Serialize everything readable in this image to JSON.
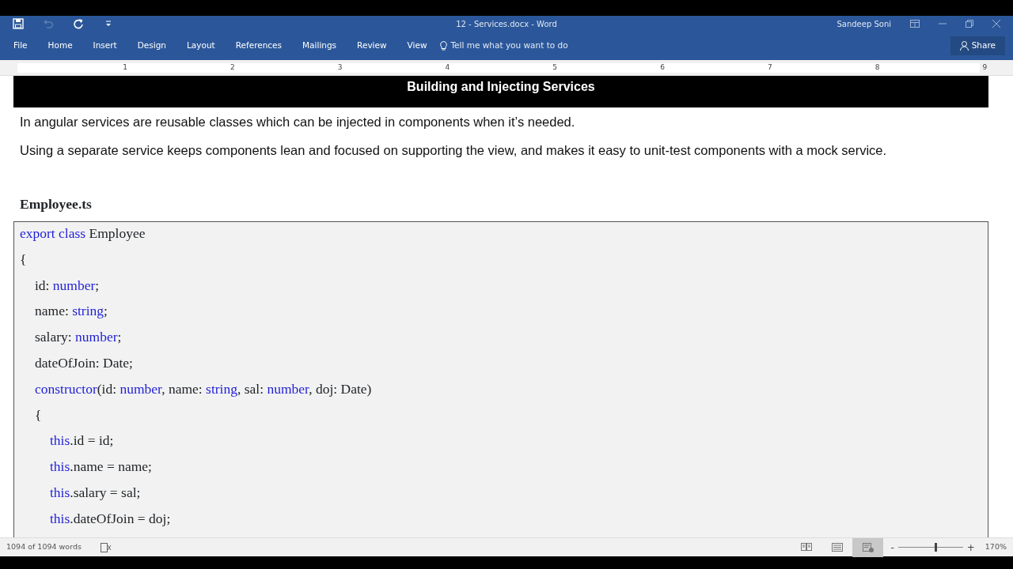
{
  "window": {
    "title": "12 - Services.docx  -  Word",
    "user": "Sandeep Soni"
  },
  "quick_access": [
    {
      "kind": "save",
      "disabled": false
    },
    {
      "kind": "undo",
      "disabled": true
    },
    {
      "kind": "repeat",
      "disabled": false
    },
    {
      "kind": "customize",
      "disabled": false
    }
  ],
  "ribbon_tabs": [
    {
      "label": "File"
    },
    {
      "label": "Home"
    },
    {
      "label": "Insert"
    },
    {
      "label": "Design"
    },
    {
      "label": "Layout"
    },
    {
      "label": "References"
    },
    {
      "label": "Mailings"
    },
    {
      "label": "Review"
    },
    {
      "label": "View"
    }
  ],
  "tell_me": {
    "placeholder": "Tell me what you want to do"
  },
  "share_button": "Share",
  "ruler": [
    "1",
    "2",
    "3",
    "4",
    "5",
    "6",
    "7",
    "8",
    "9"
  ],
  "document": {
    "heading": "Building and Injecting Services",
    "paragraphs": [
      "In angular services are reusable classes which can be injected in components when it’s needed.",
      "Using a separate service keeps components lean and focused on supporting the view, and makes it easy to unit-test components with a mock service."
    ],
    "file_heading": "Employee.ts",
    "code": [
      {
        "tokens": [
          {
            "text": "export class",
            "kind": "keyword"
          },
          {
            "text": " Employee",
            "kind": "plain"
          }
        ]
      },
      {
        "tokens": [
          {
            "text": "{",
            "kind": "plain"
          }
        ],
        "children": [
          {
            "tokens": [
              {
                "text": "id: ",
                "kind": "plain"
              },
              {
                "text": "number",
                "kind": "keyword"
              },
              {
                "text": ";",
                "kind": "plain"
              }
            ]
          },
          {
            "tokens": [
              {
                "text": "name: ",
                "kind": "plain"
              },
              {
                "text": "string",
                "kind": "keyword"
              },
              {
                "text": ";",
                "kind": "plain"
              }
            ]
          },
          {
            "tokens": [
              {
                "text": "salary: ",
                "kind": "plain"
              },
              {
                "text": "number",
                "kind": "keyword"
              },
              {
                "text": ";",
                "kind": "plain"
              }
            ]
          },
          {
            "tokens": [
              {
                "text": "dateOfJoin: Date;",
                "kind": "plain"
              }
            ]
          },
          {
            "tokens": [
              {
                "text": "constructor",
                "kind": "keyword"
              },
              {
                "text": "(id: ",
                "kind": "plain"
              },
              {
                "text": "number",
                "kind": "keyword"
              },
              {
                "text": ", name: ",
                "kind": "plain"
              },
              {
                "text": "string",
                "kind": "keyword"
              },
              {
                "text": ", sal: ",
                "kind": "plain"
              },
              {
                "text": "number",
                "kind": "keyword"
              },
              {
                "text": ", doj: Date)",
                "kind": "plain"
              }
            ]
          },
          {
            "tokens": [
              {
                "text": "{",
                "kind": "plain"
              }
            ],
            "children": [
              {
                "tokens": [
                  {
                    "text": "this",
                    "kind": "keyword"
                  },
                  {
                    "text": ".id = id;",
                    "kind": "plain"
                  }
                ]
              },
              {
                "tokens": [
                  {
                    "text": "this",
                    "kind": "keyword"
                  },
                  {
                    "text": ".name = name;",
                    "kind": "plain"
                  }
                ]
              },
              {
                "tokens": [
                  {
                    "text": "this",
                    "kind": "keyword"
                  },
                  {
                    "text": ".salary = sal;",
                    "kind": "plain"
                  }
                ]
              },
              {
                "tokens": [
                  {
                    "text": "this",
                    "kind": "keyword"
                  },
                  {
                    "text": ".dateOfJoin = doj;",
                    "kind": "plain"
                  }
                ]
              }
            ]
          }
        ]
      }
    ]
  },
  "status_bar": {
    "word_count": "1094 of 1094 words",
    "views": [
      {
        "kind": "read",
        "selected": false
      },
      {
        "kind": "print",
        "selected": false
      },
      {
        "kind": "web",
        "selected": true
      }
    ],
    "zoom": {
      "minus": "-",
      "plus": "+",
      "level": 0.58,
      "reading": "170%"
    }
  }
}
